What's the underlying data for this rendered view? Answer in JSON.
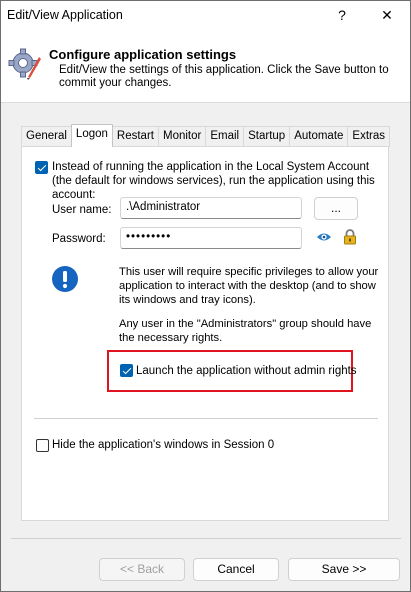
{
  "window": {
    "title": "Edit/View Application",
    "help_label": "?",
    "close_label": "✕"
  },
  "header": {
    "title": "Configure application settings",
    "description": "Edit/View the settings of this application. Click the Save button to commit your changes."
  },
  "tabs": [
    {
      "label": "General",
      "active": false
    },
    {
      "label": "Logon",
      "active": true
    },
    {
      "label": "Restart",
      "active": false
    },
    {
      "label": "Monitor",
      "active": false
    },
    {
      "label": "Email",
      "active": false
    },
    {
      "label": "Startup",
      "active": false
    },
    {
      "label": "Automate",
      "active": false
    },
    {
      "label": "Extras",
      "active": false
    }
  ],
  "logon": {
    "run_as_label": "Instead of running the application in the Local System Account (the default for windows services), run the application using this account:",
    "run_as_checked": true,
    "username_label": "User name:",
    "username_value": ".\\Administrator",
    "browse_label": "...",
    "password_label": "Password:",
    "password_value": "•••••••••",
    "info_text_1": "This user will require specific privileges to allow your application to interact with the desktop (and to show its windows and tray icons).",
    "info_text_2": "Any user in the \"Administrators\" group should have the necessary rights.",
    "launch_label": "Launch the application without admin rights",
    "launch_checked": true,
    "hide_label": "Hide the application's windows in Session 0",
    "hide_checked": false
  },
  "footer": {
    "back_label": "<< Back",
    "cancel_label": "Cancel",
    "save_label": "Save >>"
  },
  "colors": {
    "accent": "#0063b1",
    "highlight": "#e0141e"
  }
}
